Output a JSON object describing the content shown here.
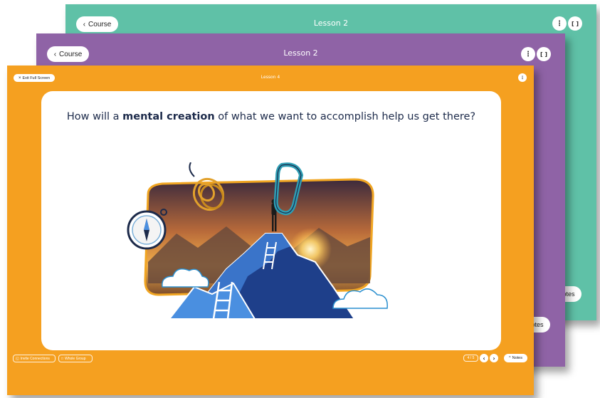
{
  "colors": {
    "green": "#5fc1a7",
    "purple": "#8f63a6",
    "orange": "#f5a020",
    "navy": "#1c2a4a"
  },
  "back_panel": {
    "course_label": "Course",
    "title": "Lesson 2",
    "notes_label": "otes",
    "icons": [
      "chevron-left-icon",
      "more-vertical-icon",
      "fullscreen-icon"
    ]
  },
  "middle_panel": {
    "course_label": "Course",
    "title": "Lesson 2",
    "notes_label": "otes",
    "icons": [
      "chevron-left-icon",
      "more-vertical-icon",
      "fullscreen-icon"
    ]
  },
  "front_panel": {
    "exit_label": "Exit Full Screen",
    "title": "Lesson 4",
    "question": {
      "before": "How will a ",
      "bold": "mental creation",
      "after": " of what we want to accomplish help us get there?"
    },
    "illustration_icons": [
      "compass-icon",
      "rope-icon",
      "carabiner-icon",
      "mountain-icon",
      "person-icon",
      "ladder-icon",
      "cloud-icon"
    ],
    "footer": {
      "invite_label": "Invite Connections",
      "group_label": "Whole Group",
      "page_indicator": "4 / 5",
      "notes_label": "Notes"
    }
  }
}
